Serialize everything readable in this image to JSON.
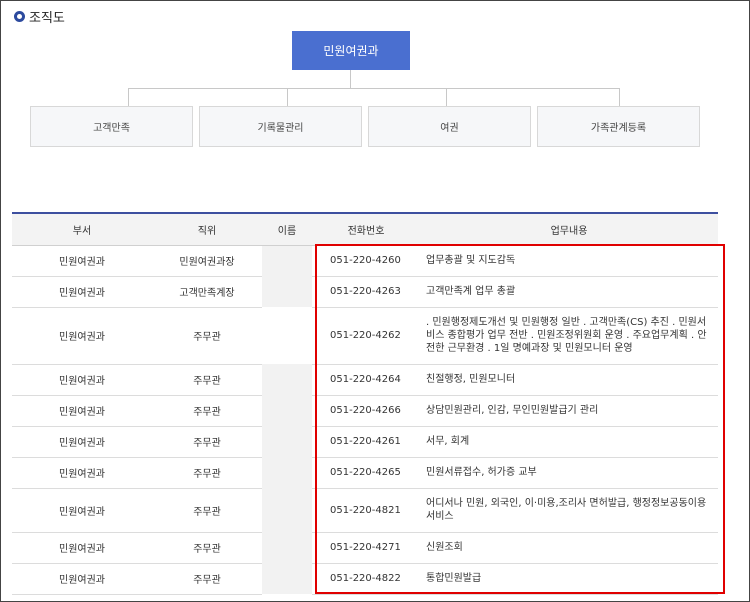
{
  "section": {
    "title": "조직도"
  },
  "org": {
    "head": "민원여권과",
    "children": [
      "고객만족",
      "기록물관리",
      "여권",
      "가족관계등록"
    ]
  },
  "table": {
    "headers": [
      "부서",
      "직위",
      "이름",
      "전화번호",
      "업무내용"
    ],
    "rows": [
      {
        "dept": "민원여권과",
        "position": "민원여권과장",
        "name": "",
        "phone": "051-220-4260",
        "duty": "업무총괄 및 지도감독"
      },
      {
        "dept": "민원여권과",
        "position": "고객만족계장",
        "name": "",
        "phone": "051-220-4263",
        "duty": "고객만족계 업무 총괄"
      },
      {
        "dept": "민원여권과",
        "position": "주무관",
        "name": "",
        "phone": "051-220-4262",
        "duty": ". 민원행정제도개선 및 민원행정 일반 . 고객만족(CS) 추진 . 민원서비스 종합평가 업무 전반 . 민원조정위원회 운영 . 주요업무계획 . 안전한 근무환경 . 1일 명예과장 및 민원모니터 운영"
      },
      {
        "dept": "민원여권과",
        "position": "주무관",
        "name": "",
        "phone": "051-220-4264",
        "duty": "친절행정, 민원모니터"
      },
      {
        "dept": "민원여권과",
        "position": "주무관",
        "name": "",
        "phone": "051-220-4266",
        "duty": "상담민원관리, 인감, 무인민원발급기 관리"
      },
      {
        "dept": "민원여권과",
        "position": "주무관",
        "name": "",
        "phone": "051-220-4261",
        "duty": "서무, 회계"
      },
      {
        "dept": "민원여권과",
        "position": "주무관",
        "name": "",
        "phone": "051-220-4265",
        "duty": "민원서류접수, 허가증 교부"
      },
      {
        "dept": "민원여권과",
        "position": "주무관",
        "name": "",
        "phone": "051-220-4821",
        "duty": "어디서나 민원, 외국인, 이·미용,조리사 면허발급, 행정정보공동이용서비스"
      },
      {
        "dept": "민원여권과",
        "position": "주무관",
        "name": "",
        "phone": "051-220-4271",
        "duty": "신원조회"
      },
      {
        "dept": "민원여권과",
        "position": "주무관",
        "name": "",
        "phone": "051-220-4822",
        "duty": "통합민원발급"
      }
    ]
  },
  "colors": {
    "accent": "#4a6fd0",
    "header_rule": "#3d4f9f",
    "highlight": "#e00000"
  }
}
